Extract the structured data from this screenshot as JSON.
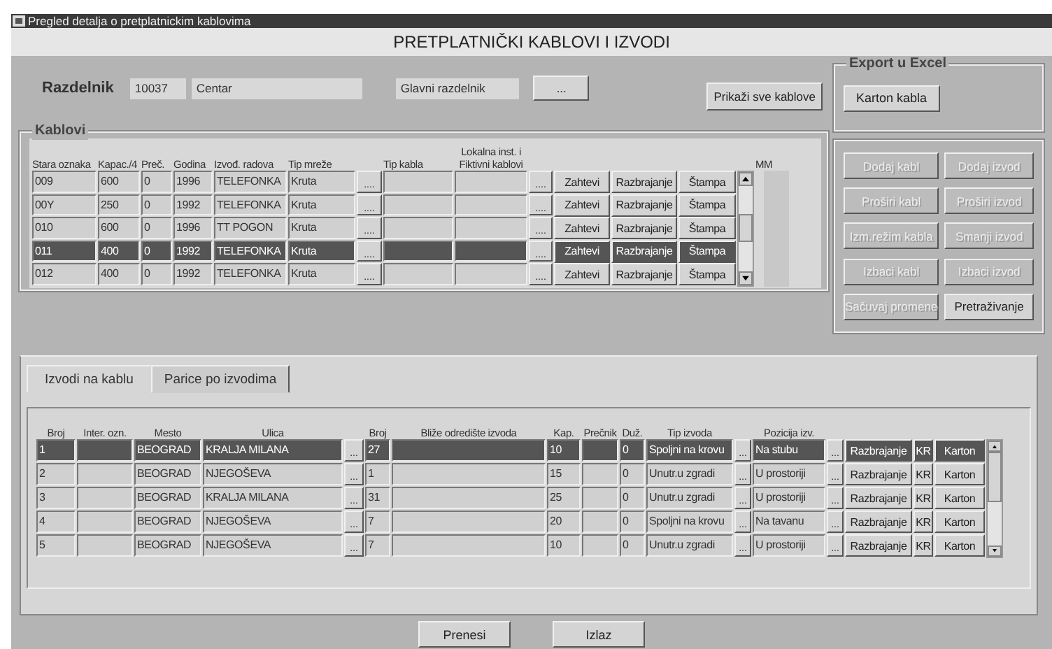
{
  "window": {
    "title": "Pregled detalja o pretplatnickim kablovima"
  },
  "header": {
    "title": "PRETPLATNIČKI KABLOVI I IZVODI"
  },
  "razdelnik": {
    "label": "Razdelnik",
    "code": "10037",
    "name": "Centar",
    "type": "Glavni razdelnik",
    "lookup_button": "...",
    "show_all_button": "Prikaži sve kablove"
  },
  "export": {
    "legend": "Export u Excel",
    "button": "Karton kabla"
  },
  "kablovi": {
    "legend": "Kablovi",
    "columns": [
      "Stara oznaka",
      "Kapac./4",
      "Preč.",
      "Godina",
      "Izvođ. radova",
      "Tip mreže",
      "Tip kabla",
      "Lokalna inst. i Fiktivni kablovi"
    ],
    "mm_label": "MM",
    "rows": [
      {
        "stara_oznaka": "009",
        "kapacitet": "600",
        "precnik": "0",
        "godina": "1996",
        "izvodjac": "TELEFONKA",
        "tip_mreze": "Kruta",
        "lookups": [
          "....",
          "...."
        ],
        "buttons": [
          "Zahtevi",
          "Razbrajanje",
          "Štampa"
        ],
        "selected": false
      },
      {
        "stara_oznaka": "00Y",
        "kapacitet": "250",
        "precnik": "0",
        "godina": "1992",
        "izvodjac": "TELEFONKA",
        "tip_mreze": "Kruta",
        "lookups": [
          "....",
          "...."
        ],
        "buttons": [
          "Zahtevi",
          "Razbrajanje",
          "Štampa"
        ],
        "selected": false
      },
      {
        "stara_oznaka": "010",
        "kapacitet": "600",
        "precnik": "0",
        "godina": "1996",
        "izvodjac": "TT POGON",
        "tip_mreze": "Kruta",
        "lookups": [
          "....",
          "...."
        ],
        "buttons": [
          "Zahtevi",
          "Razbrajanje",
          "Štampa"
        ],
        "selected": false
      },
      {
        "stara_oznaka": "011",
        "kapacitet": "400",
        "precnik": "0",
        "godina": "1992",
        "izvodjac": "TELEFONKA",
        "tip_mreze": "Kruta",
        "lookups": [
          "....",
          "...."
        ],
        "buttons": [
          "Zahtevi",
          "Razbrajanje",
          "Štampa"
        ],
        "selected": true
      },
      {
        "stara_oznaka": "012",
        "kapacitet": "400",
        "precnik": "0",
        "godina": "1992",
        "izvodjac": "TELEFONKA",
        "tip_mreze": "Kruta",
        "lookups": [
          "....",
          "...."
        ],
        "buttons": [
          "Zahtevi",
          "Razbrajanje",
          "Štampa"
        ],
        "selected": false
      }
    ]
  },
  "actions": [
    {
      "label": "Dodaj kabl",
      "disabled": true
    },
    {
      "label": "Dodaj izvod",
      "disabled": true
    },
    {
      "label": "Proširi kabl",
      "disabled": true
    },
    {
      "label": "Proširi izvod",
      "disabled": true
    },
    {
      "label": "Izm.režim kabla",
      "disabled": true
    },
    {
      "label": "Smanji izvod",
      "disabled": true
    },
    {
      "label": "Izbaci kabl",
      "disabled": true
    },
    {
      "label": "Izbaci izvod",
      "disabled": true
    },
    {
      "label": "Sačuvaj promene",
      "disabled": true
    },
    {
      "label": "Pretraživanje",
      "disabled": false
    }
  ],
  "tabs": [
    {
      "label": "Izvodi na kablu",
      "selected": true
    },
    {
      "label": "Parice po izvodima",
      "selected": false
    }
  ],
  "izvodi": {
    "columns": [
      "Broj",
      "Inter. ozn.",
      "Mesto",
      "Ulica",
      "Broj",
      "Bliže odredište izvoda",
      "Kap.",
      "Prečnik",
      "Duž.",
      "Tip izvoda",
      "Pozicija izv."
    ],
    "rows": [
      {
        "broj": "1",
        "mesto": "BEOGRAD",
        "ulica": "KRALJA MILANA",
        "kucni_broj": "27",
        "kap": "10",
        "duz": "0",
        "tip": "Spoljni na krovu",
        "pozicija": "Na stubu",
        "lookups": [
          "...",
          "...",
          "..."
        ],
        "buttons": [
          "Razbrajanje",
          "KR",
          "Karton"
        ],
        "selected": true
      },
      {
        "broj": "2",
        "mesto": "BEOGRAD",
        "ulica": "NJEGOŠEVA",
        "kucni_broj": "1",
        "kap": "15",
        "duz": "0",
        "tip": "Unutr.u zgradi",
        "pozicija": "U prostoriji",
        "lookups": [
          "...",
          "...",
          "..."
        ],
        "buttons": [
          "Razbrajanje",
          "KR",
          "Karton"
        ],
        "selected": false
      },
      {
        "broj": "3",
        "mesto": "BEOGRAD",
        "ulica": "KRALJA MILANA",
        "kucni_broj": "31",
        "kap": "25",
        "duz": "0",
        "tip": "Unutr.u zgradi",
        "pozicija": "U prostoriji",
        "lookups": [
          "...",
          "...",
          "..."
        ],
        "buttons": [
          "Razbrajanje",
          "KR",
          "Karton"
        ],
        "selected": false
      },
      {
        "broj": "4",
        "mesto": "BEOGRAD",
        "ulica": "NJEGOŠEVA",
        "kucni_broj": "7",
        "kap": "20",
        "duz": "0",
        "tip": "Spoljni na krovu",
        "pozicija": "Na tavanu",
        "lookups": [
          "...",
          "...",
          "..."
        ],
        "buttons": [
          "Razbrajanje",
          "KR",
          "Karton"
        ],
        "selected": false
      },
      {
        "broj": "5",
        "mesto": "BEOGRAD",
        "ulica": "NJEGOŠEVA",
        "kucni_broj": "7",
        "kap": "10",
        "duz": "0",
        "tip": "Unutr.u zgradi",
        "pozicija": "U prostoriji",
        "lookups": [
          "...",
          "...",
          "..."
        ],
        "buttons": [
          "Razbrajanje",
          "KR",
          "Karton"
        ],
        "selected": false
      }
    ]
  },
  "bottom_buttons": [
    "Prenesi",
    "Izlaz"
  ]
}
